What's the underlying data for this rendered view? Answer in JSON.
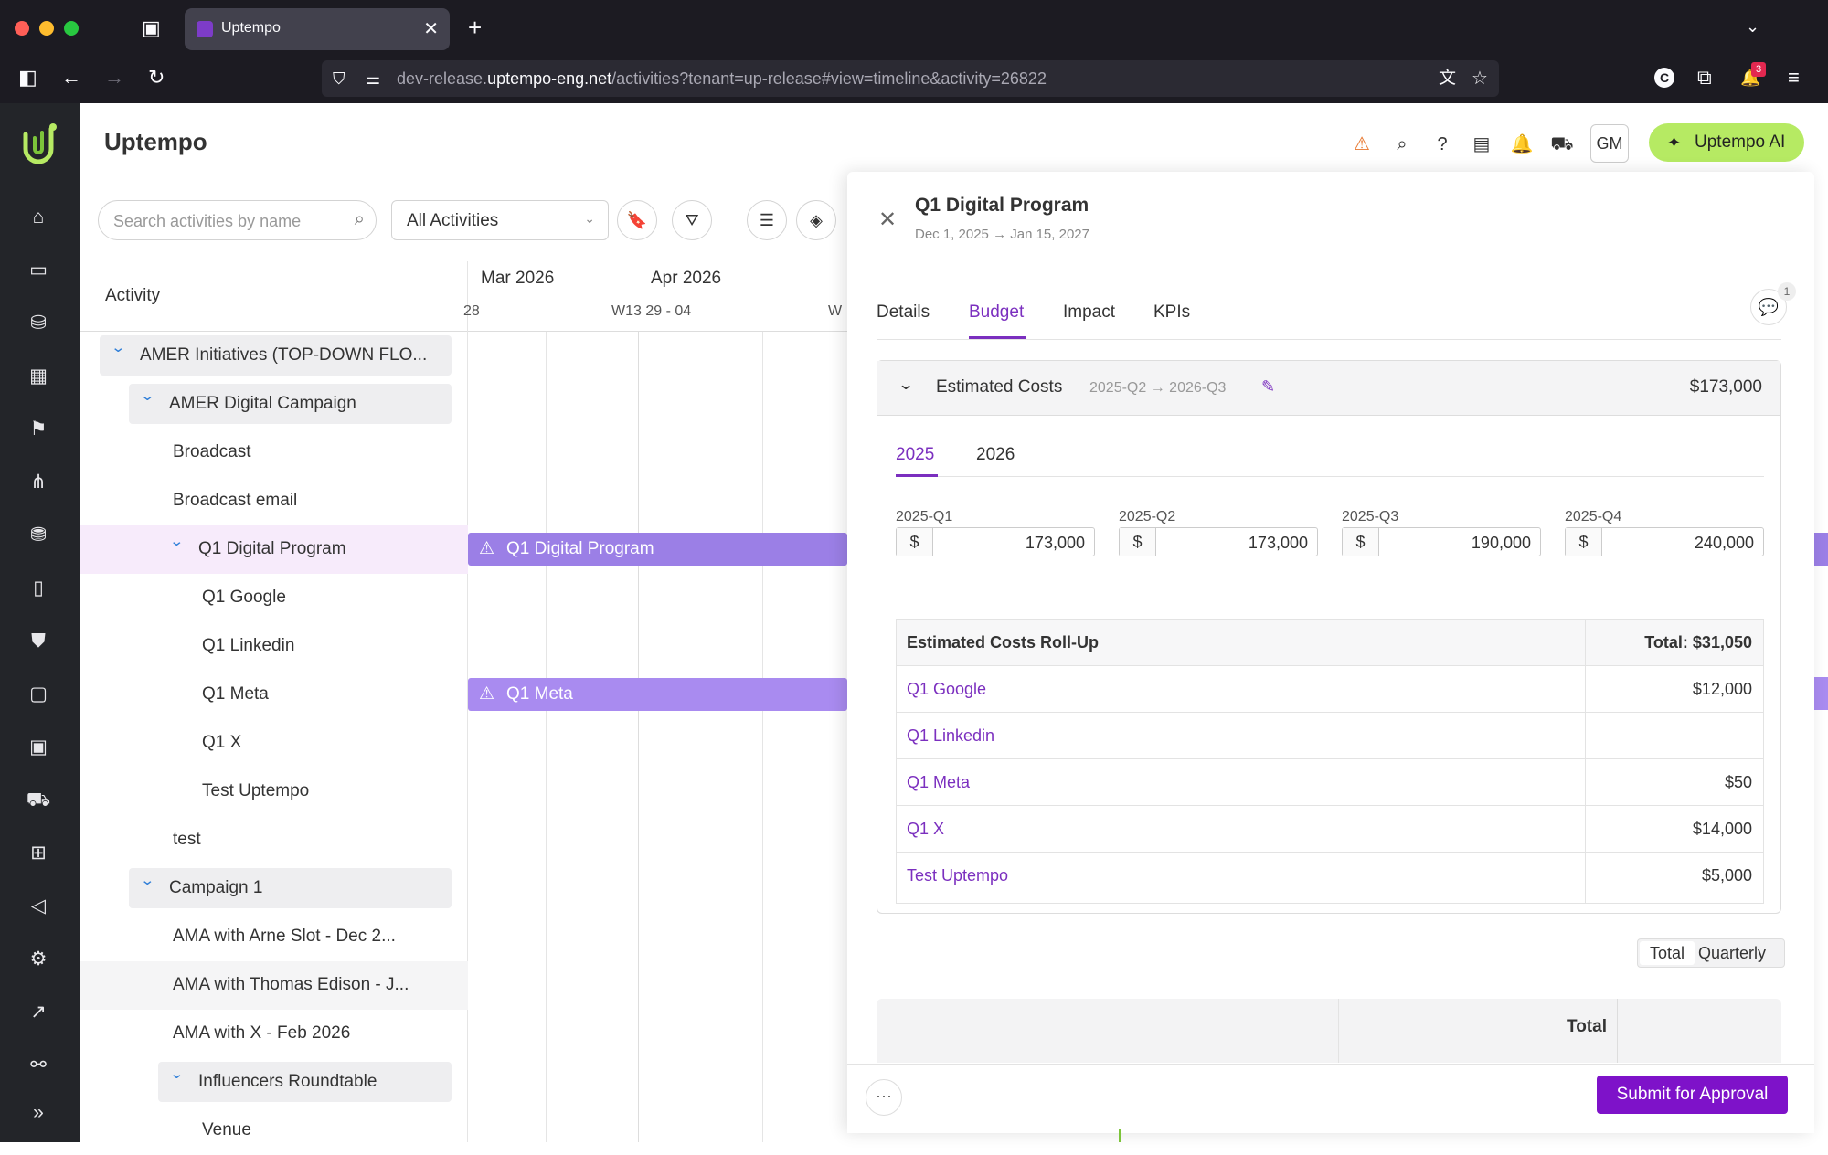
{
  "browser": {
    "tab_title": "Uptempo",
    "url_prefix": "dev-release.",
    "url_domain": "uptempo-eng.net",
    "url_path": "/activities?tenant=up-release#view=timeline&activity=26822",
    "notif_count": "3"
  },
  "app": {
    "title": "Uptempo",
    "user_initials": "GM",
    "ai_label": "Uptempo AI"
  },
  "toolbar": {
    "search_placeholder": "Search activities by name",
    "filter_value": "All Activities"
  },
  "timeline": {
    "activity_header": "Activity",
    "months": [
      "Mar 2026",
      "Apr 2026"
    ],
    "weeks": [
      "28",
      "W13 29 - 04",
      "W"
    ],
    "rows": [
      {
        "label": "AMER Initiatives (TOP-DOWN FLO...",
        "level": 0,
        "group": true
      },
      {
        "label": "AMER Digital Campaign",
        "level": 1,
        "group": true
      },
      {
        "label": "Broadcast",
        "level": 2,
        "group": false
      },
      {
        "label": "Broadcast email",
        "level": 2,
        "group": false
      },
      {
        "label": "Q1 Digital Program",
        "level": 2,
        "group": true,
        "selected": true
      },
      {
        "label": "Q1 Google",
        "level": 3,
        "group": false
      },
      {
        "label": "Q1 Linkedin",
        "level": 3,
        "group": false
      },
      {
        "label": "Q1 Meta",
        "level": 3,
        "group": false
      },
      {
        "label": "Q1 X",
        "level": 3,
        "group": false
      },
      {
        "label": "Test Uptempo",
        "level": 3,
        "group": false
      },
      {
        "label": "test",
        "level": 2,
        "group": false
      },
      {
        "label": "Campaign 1",
        "level": 1,
        "group": true
      },
      {
        "label": "AMA with Arne Slot - Dec 2...",
        "level": 2,
        "group": false
      },
      {
        "label": "AMA with Thomas Edison - J...",
        "level": 2,
        "group": false,
        "hover": true
      },
      {
        "label": "AMA with X - Feb 2026",
        "level": 2,
        "group": false
      },
      {
        "label": "Influencers Roundtable",
        "level": 2,
        "group": true
      },
      {
        "label": "Venue",
        "level": 3,
        "group": false
      }
    ],
    "bars": [
      {
        "label": "Q1 Digital Program",
        "row": 4,
        "color": "#9b7fe6"
      },
      {
        "label": "Q1 Meta",
        "row": 7,
        "color": "#a98bf0"
      }
    ]
  },
  "panel": {
    "title": "Q1 Digital Program",
    "start_date": "Dec 1, 2025",
    "end_date": "Jan 15, 2027",
    "arrow": "→",
    "comment_count": "1",
    "tabs": [
      "Details",
      "Budget",
      "Impact",
      "KPIs"
    ],
    "active_tab": "Budget",
    "section": {
      "title": "Estimated Costs",
      "range_start": "2025-Q2",
      "range_end": "2026-Q3",
      "total": "$173,000",
      "year_tabs": [
        "2025",
        "2026"
      ],
      "quarters": [
        {
          "label": "2025-Q1",
          "currency": "$",
          "value": "173,000"
        },
        {
          "label": "2025-Q2",
          "currency": "$",
          "value": "173,000"
        },
        {
          "label": "2025-Q3",
          "currency": "$",
          "value": "190,000"
        },
        {
          "label": "2025-Q4",
          "currency": "$",
          "value": "240,000"
        }
      ],
      "rollup": {
        "title": "Estimated Costs Roll-Up",
        "total": "Total: $31,050",
        "rows": [
          {
            "name": "Q1 Google",
            "amount": "$12,000"
          },
          {
            "name": "Q1 Linkedin",
            "amount": ""
          },
          {
            "name": "Q1 Meta",
            "amount": "$50"
          },
          {
            "name": "Q1 X",
            "amount": "$14,000"
          },
          {
            "name": "Test Uptempo",
            "amount": "$5,000"
          }
        ]
      }
    },
    "view_toggle": [
      "Total",
      "Quarterly"
    ],
    "table_header_total": "Total",
    "more_label": "···",
    "submit_label": "Submit for Approval"
  },
  "colors": {
    "accent": "#7b2fbf",
    "submit": "#7e12c9",
    "ai": "#b6ea63",
    "warning": "#e8772e"
  }
}
